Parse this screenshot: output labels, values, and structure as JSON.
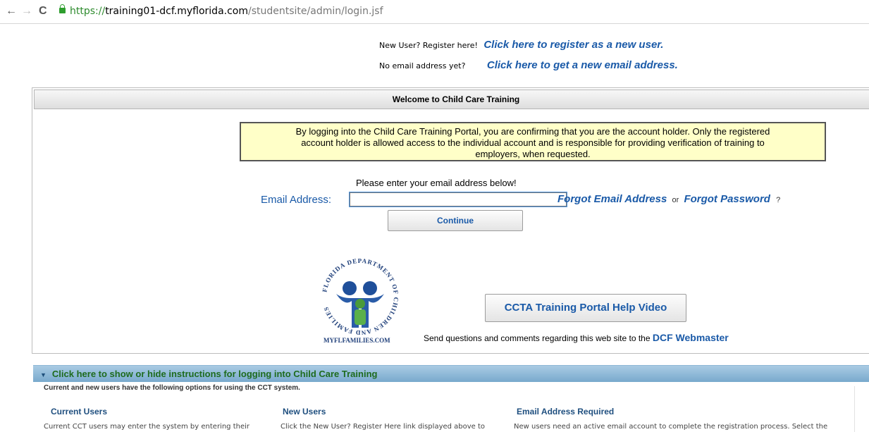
{
  "browser": {
    "url_proto": "https://",
    "url_host": "training01-dcf.myflorida.com",
    "url_path": "/studentsite/admin/login.jsf"
  },
  "top_links": {
    "new_user_prompt": "New User? Register here!",
    "register_link": "Click here to register as a new user.",
    "no_email_prompt": "No email address yet?",
    "new_email_link": "Click here to get a new email address."
  },
  "panel": {
    "header": "Welcome to Child Care Training",
    "notice_lines": [
      "By logging into the Child Care Training Portal, you are confirming that you are the account holder. Only the registered",
      "account holder is allowed access to the individual account and is responsible for providing verification of training to",
      "employers, when requested."
    ],
    "enter_email": "Please enter your email address below!",
    "email_label": "Email Address:",
    "email_value": "",
    "forgot_email": "Forgot Email Address",
    "or": "or",
    "forgot_password": "Forgot Password",
    "question_mark": "?",
    "continue_label": "Continue",
    "help_video_label": "CCTA Training Portal Help Video",
    "send_questions": "Send questions and comments regarding this web site to the",
    "webmaster_link": "DCF Webmaster",
    "logo": {
      "arc_text": "FLORIDA DEPARTMENT OF CHILDREN AND FAMILIES",
      "caption": "MYFLFAMILIES.COM"
    }
  },
  "instructions": {
    "toggle_label": "Click here to show or hide instructions for logging into Child Care Training",
    "options_text": "Current and new users have the following options for using the CCT system.",
    "columns": [
      {
        "title": "Current Users",
        "text": "Current CCT users may enter the system by entering their"
      },
      {
        "title": "New Users",
        "text": "Click the New User? Register Here link displayed above to"
      },
      {
        "title": "Email Address Required",
        "text": "New users need an active email account to complete the registration process. Select the"
      }
    ]
  },
  "colors": {
    "link_blue": "#1a5aa8",
    "notice_bg": "#ffffc8",
    "instructions_green": "#1e6b1e"
  }
}
